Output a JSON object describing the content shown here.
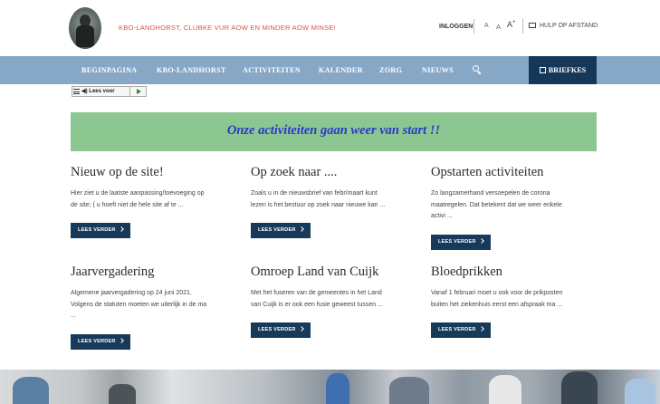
{
  "header": {
    "tagline": "KBO-LANDHORST, CLUBKE VUR AOW EN MINDER AOW MINSE!",
    "login": "INLOGGEN",
    "font_small": "A",
    "font_medium": "A",
    "font_large": "A",
    "font_large_sup": "+",
    "help": "HULP OP AFSTAND"
  },
  "nav": {
    "items": [
      "BEGINPAGINA",
      "KBO-LANDHORST",
      "ACTIVITEITEN",
      "KALENDER",
      "ZORG",
      "NIEUWS"
    ],
    "briefkes": "BRIEFKES"
  },
  "readaloud": {
    "label": "Lees voor"
  },
  "banner": {
    "text": "Onze activiteiten gaan weer van start !!"
  },
  "cards": [
    {
      "title": "Nieuw op de site!",
      "excerpt_lines": [
        "Hier ziet u de laatste aanpassing/toevoeging op",
        "de site; ( u hoeft niet de hele site af te ..."
      ],
      "button": "LEES VERDER"
    },
    {
      "title": "Op zoek naar ....",
      "excerpt_lines": [
        "Zoals u in de nieuwsbrief van febr/maart kunt",
        "lezen is het bestuur op zoek naar nieuwe kan ..."
      ],
      "button": "LEES VERDER"
    },
    {
      "title": "Opstarten activiteiten",
      "excerpt_lines": [
        "Zo langzamerhand versoepelen de corona",
        "maatregelen. Dat betekent dat we weer enkele",
        "activi ..."
      ],
      "button": "LEES VERDER"
    },
    {
      "title": "Jaarvergadering",
      "excerpt_lines": [
        "Algemene jaarvergadering op 24 juni 2021.",
        "Volgens de statuten moeten we uiterlijk in de ma",
        "..."
      ],
      "button": "LEES VERDER"
    },
    {
      "title": "Omroep Land van Cuijk",
      "excerpt_lines": [
        "Met het fuseren van de gemeentes in het Land",
        "van Cuijk is er ook een fusie geweest tussen ..."
      ],
      "button": "LEES VERDER"
    },
    {
      "title": "Bloedprikken",
      "excerpt_lines": [
        "Vanaf 1 februari moet u ook voor de prikposten",
        "buiten het ziekenhuis eerst een afspraak ma ..."
      ],
      "button": "LEES VERDER"
    }
  ],
  "colors": {
    "nav_bg": "#86a7c6",
    "briefkes_bg": "#163858",
    "button_bg": "#173a5b",
    "banner_bg": "#8cc791",
    "banner_text": "#2a39c9",
    "tagline": "#d9534f"
  }
}
